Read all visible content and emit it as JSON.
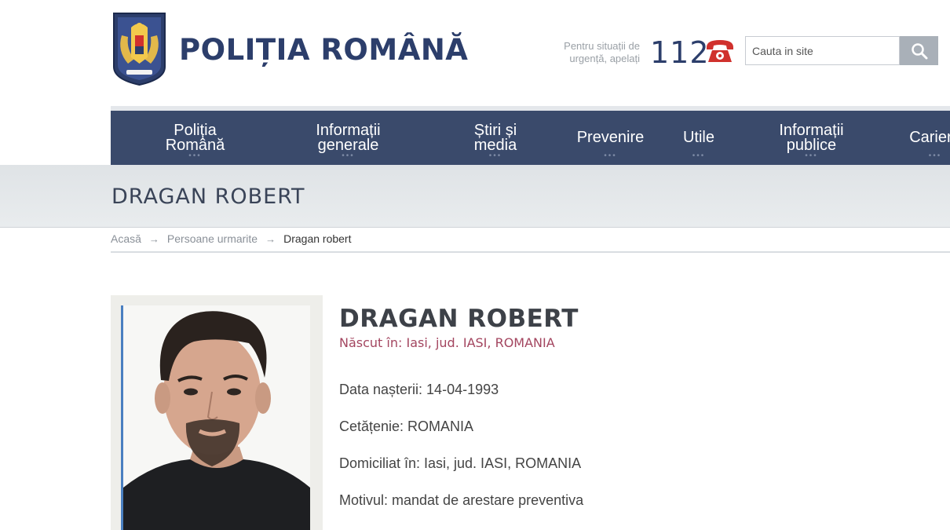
{
  "header": {
    "brand": "POLIȚIA ROMÂNĂ",
    "emergency_line1": "Pentru situații de",
    "emergency_line2": "urgență, apelați",
    "emergency_number": "112",
    "search_placeholder": "Cauta in site"
  },
  "nav": {
    "items": [
      {
        "line1": "Poliția",
        "line2": "Română",
        "dots": "•••"
      },
      {
        "line1": "Informații",
        "line2": "generale",
        "dots": "•••"
      },
      {
        "line1": "Știri și",
        "line2": "media",
        "dots": "•••"
      },
      {
        "line1": "Prevenire",
        "line2": "",
        "dots": "•••"
      },
      {
        "line1": "Utile",
        "line2": "",
        "dots": "•••"
      },
      {
        "line1": "Informații",
        "line2": "publice",
        "dots": "•••"
      },
      {
        "line1": "Cariere",
        "line2": "",
        "dots": "•••"
      }
    ]
  },
  "page": {
    "title": "DRAGAN ROBERT"
  },
  "breadcrumb": {
    "home": "Acasă",
    "section": "Persoane urmarite",
    "current": "Dragan robert",
    "separator": "→"
  },
  "person": {
    "name": "DRAGAN ROBERT",
    "birthplace": "Născut în: Iasi, jud. IASI, ROMANIA",
    "birth_date": "Data nașterii: 14-04-1993",
    "citizenship": "Cetățenie: ROMANIA",
    "domicile": "Domiciliat în: Iasi, jud. IASI, ROMANIA",
    "reason": "Motivul: mandat de arestare preventiva"
  },
  "colors": {
    "nav_bg": "#3a4a6b",
    "brand": "#2c3e6b",
    "accent_red": "#d0312d",
    "birthplace": "#a3455f"
  },
  "icons": {
    "crest": "romanian-police-crest",
    "phone": "telephone-icon",
    "search": "magnifier-icon"
  }
}
